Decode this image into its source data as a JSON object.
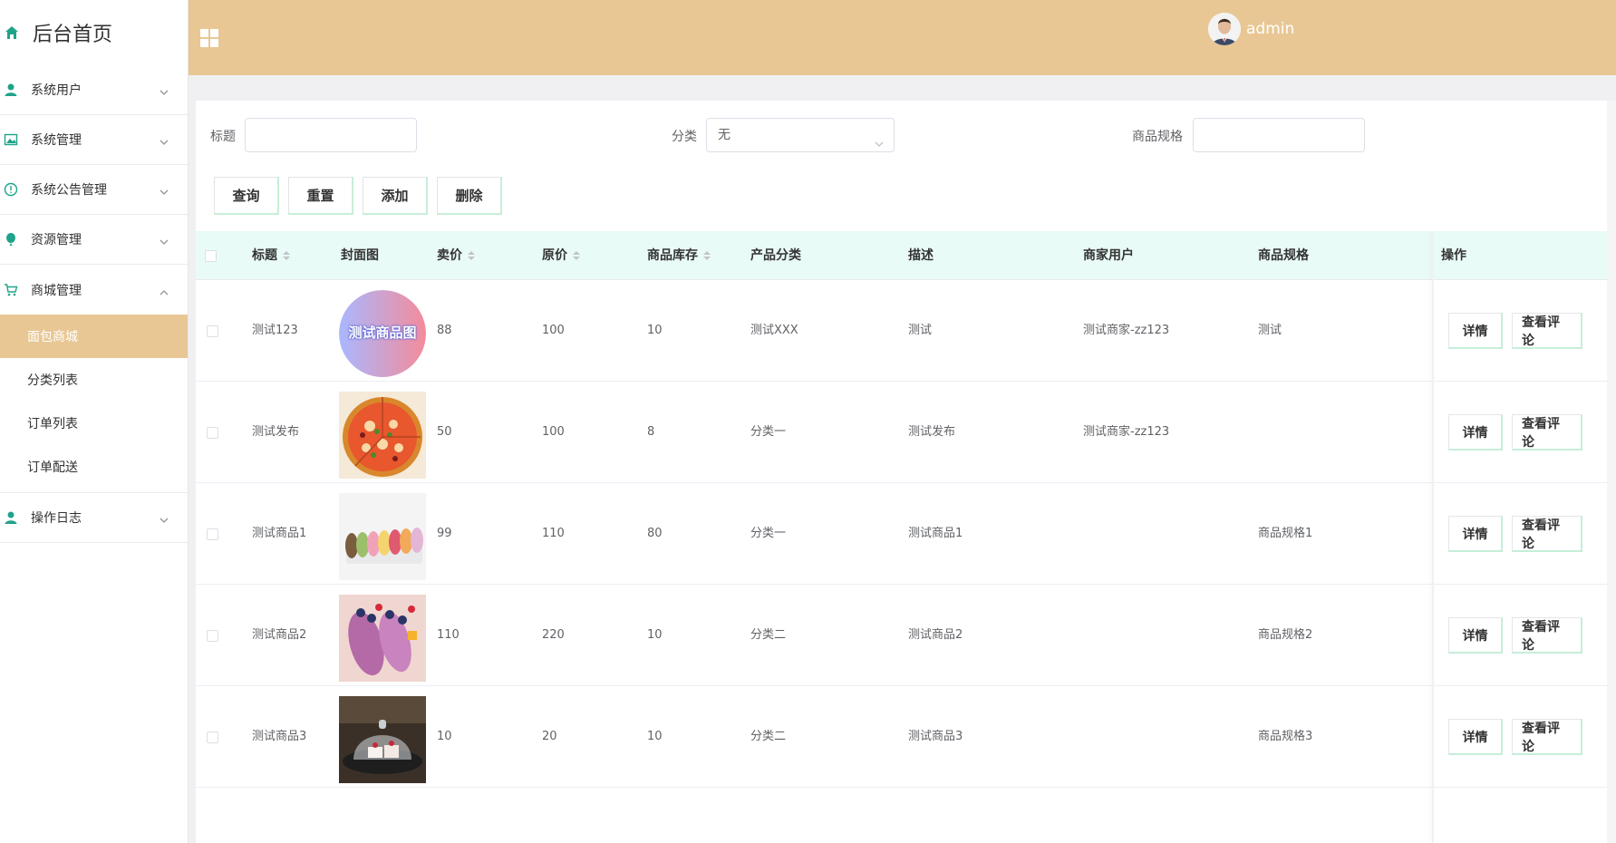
{
  "sidebar": {
    "home_title": "后台首页",
    "menus": [
      {
        "label": "系统用户"
      },
      {
        "label": "系统管理"
      },
      {
        "label": "系统公告管理"
      },
      {
        "label": "资源管理"
      },
      {
        "label": "商城管理"
      }
    ],
    "sub_items": [
      "面包商城",
      "分类列表",
      "订单列表",
      "订单配送"
    ],
    "last_menu": {
      "label": "操作日志"
    }
  },
  "header": {
    "username": "admin"
  },
  "search": {
    "title_label": "标题",
    "title_value": "",
    "category_label": "分类",
    "category_value": "无",
    "spec_label": "商品规格",
    "spec_value": ""
  },
  "toolbar": {
    "query": "查询",
    "reset": "重置",
    "add": "添加",
    "delete": "删除"
  },
  "table": {
    "columns": {
      "title": "标题",
      "cover": "封面图",
      "price": "卖价",
      "original": "原价",
      "stock": "商品库存",
      "category": "产品分类",
      "desc": "描述",
      "merchant": "商家用户",
      "spec": "商品规格",
      "ops": "操作"
    },
    "rows": [
      {
        "title": "测试123",
        "cover_text": "测试商品图",
        "price": "88",
        "original": "100",
        "stock": "10",
        "category": "测试XXX",
        "desc": "测试",
        "merchant": "测试商家-zz123",
        "spec": "测试"
      },
      {
        "title": "测试发布",
        "price": "50",
        "original": "100",
        "stock": "8",
        "category": "分类一",
        "desc": "测试发布",
        "merchant": "测试商家-zz123",
        "spec": ""
      },
      {
        "title": "测试商品1",
        "price": "99",
        "original": "110",
        "stock": "80",
        "category": "分类一",
        "desc": "测试商品1",
        "merchant": "",
        "spec": "商品规格1"
      },
      {
        "title": "测试商品2",
        "price": "110",
        "original": "220",
        "stock": "10",
        "category": "分类二",
        "desc": "测试商品2",
        "merchant": "",
        "spec": "商品规格2"
      },
      {
        "title": "测试商品3",
        "price": "10",
        "original": "20",
        "stock": "10",
        "category": "分类二",
        "desc": "测试商品3",
        "merchant": "",
        "spec": "商品规格3"
      }
    ],
    "row_actions": {
      "detail": "详情",
      "comments": "查看评论"
    }
  },
  "colors": {
    "accent": "#e8c794",
    "header_row": "#e9fbf7",
    "menu_icon": "#1fa38a"
  },
  "icons": {
    "home": "home-icon",
    "user": "user-icon",
    "picture": "picture-icon",
    "info": "info-icon",
    "resource": "balloon-icon",
    "cart": "cart-icon",
    "log": "user-icon",
    "grid": "grid-icon"
  }
}
